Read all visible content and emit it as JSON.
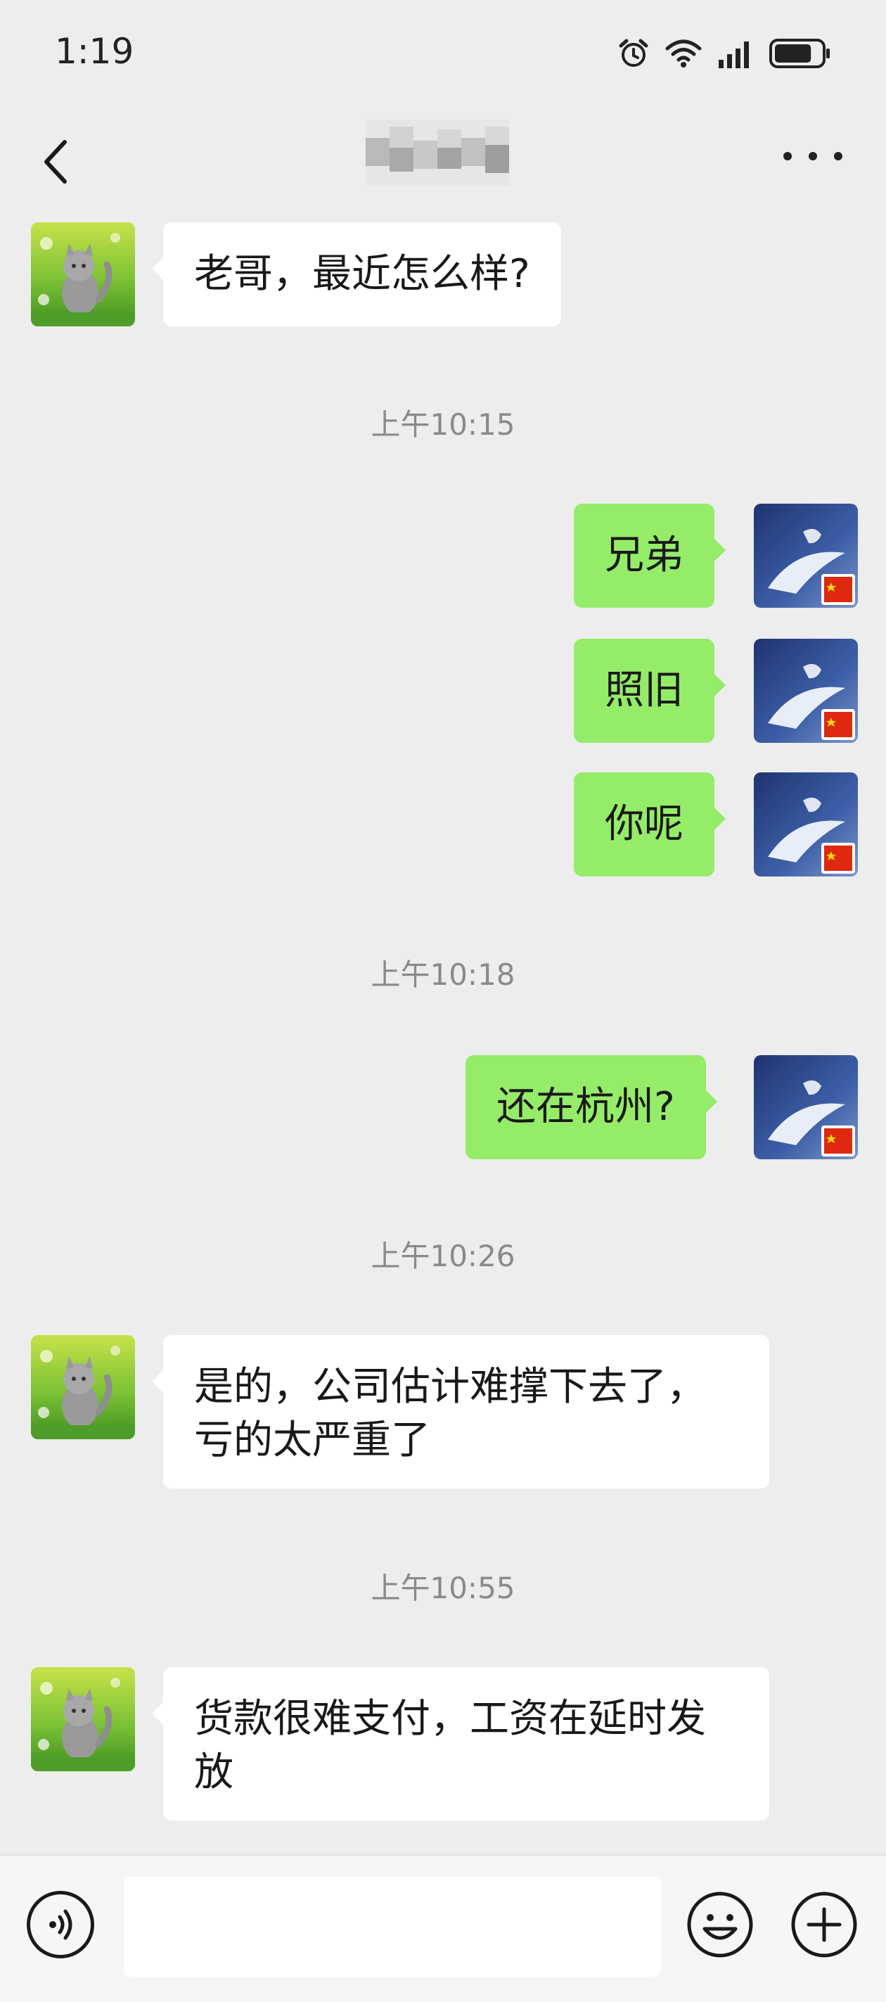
{
  "status_bar": {
    "time": "1:19",
    "battery_level": 0.8
  },
  "header": {
    "back_icon": "chevron-left-icon",
    "more_icon": "more-icon"
  },
  "messages": [
    {
      "side": "left",
      "text": "老哥，最近怎么样?"
    },
    {
      "timestamp": "上午10:15"
    },
    {
      "side": "right",
      "text": "兄弟"
    },
    {
      "side": "right",
      "text": "照旧"
    },
    {
      "side": "right",
      "text": "你呢"
    },
    {
      "timestamp": "上午10:18"
    },
    {
      "side": "right",
      "text": "还在杭州?"
    },
    {
      "timestamp": "上午10:26"
    },
    {
      "side": "left",
      "lines": [
        "是的，公司估计难撑下去了，",
        "亏的太严重了"
      ]
    },
    {
      "timestamp": "上午10:55"
    },
    {
      "side": "left",
      "lines": [
        "货款很难支付，工资在延时发",
        "放"
      ]
    }
  ],
  "input_bar": {
    "voice_icon": "voice-icon",
    "emoji_icon": "emoji-icon",
    "plus_icon": "plus-icon",
    "text_value": ""
  },
  "colors": {
    "background": "#ededed",
    "bubble_self": "#95ec69",
    "bubble_other": "#ffffff"
  }
}
